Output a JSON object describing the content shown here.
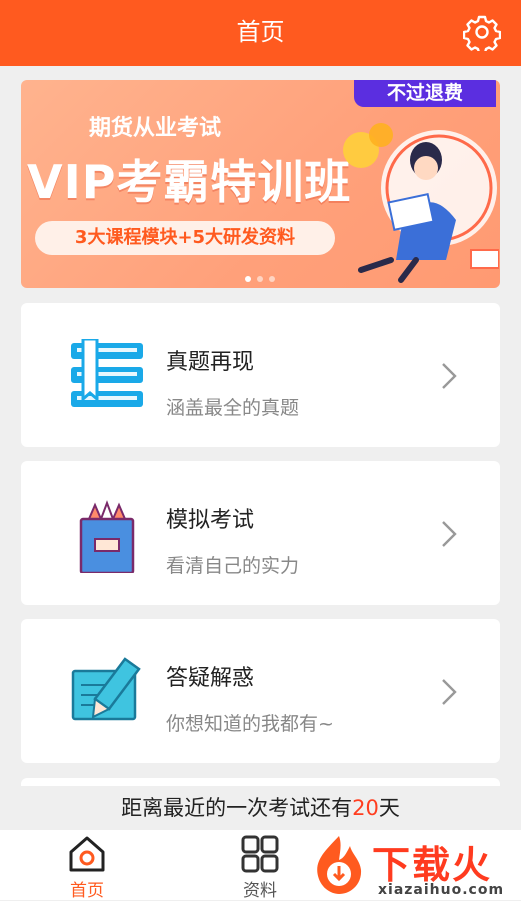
{
  "header": {
    "title": "首页"
  },
  "banner": {
    "tag": "不过退费",
    "subtitle": "期货从业考试",
    "headline": "VIP考霸特训班",
    "pill": "3大课程模块+5大研发资料",
    "slide_count": 3,
    "active_slide": 1
  },
  "cards": [
    {
      "title": "真题再现",
      "desc": "涵盖最全的真题"
    },
    {
      "title": "模拟考试",
      "desc": "看清自己的实力"
    },
    {
      "title": "答疑解惑",
      "desc": "你想知道的我都有~"
    }
  ],
  "countdown": {
    "prefix": "距离最近的一次考试还有",
    "days": "20",
    "suffix": "天"
  },
  "tabs": [
    {
      "label": "首页",
      "active": true
    },
    {
      "label": "资料",
      "active": false
    }
  ],
  "watermark": {
    "brand": "下载火",
    "url": "xiazaihuo.com"
  },
  "colors": {
    "accent": "#ff5a1f",
    "card_icon_blue": "#1aa9e8",
    "highlight": "#ff3d1f"
  },
  "icons": {
    "settings": "gear-icon",
    "card1": "book-icon",
    "card2": "pencil-cup-icon",
    "card3": "note-pencil-icon",
    "chevron": "chevron-right-icon",
    "home": "home-icon",
    "materials": "grid-icon"
  }
}
